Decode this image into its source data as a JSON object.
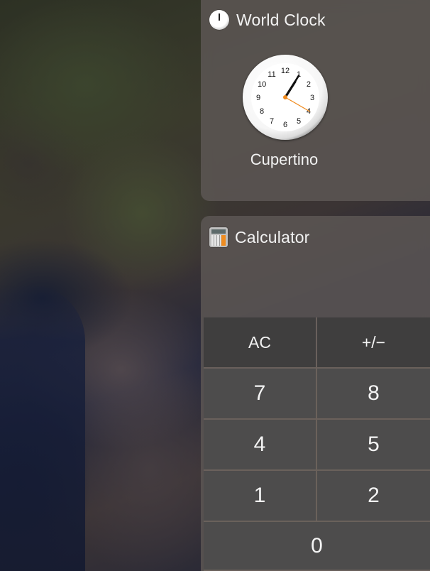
{
  "world_clock": {
    "title": "World Clock",
    "city": "Cupertino",
    "time": {
      "hour": 1,
      "minute": 5,
      "second": 20
    },
    "dial_numbers": [
      "12",
      "1",
      "2",
      "3",
      "4",
      "5",
      "6",
      "7",
      "8",
      "9",
      "10",
      "11"
    ]
  },
  "calculator": {
    "title": "Calculator",
    "keys": {
      "ac": "AC",
      "sign": "+/−",
      "seven": "7",
      "eight": "8",
      "four": "4",
      "five": "5",
      "one": "1",
      "two": "2",
      "zero": "0"
    }
  },
  "colors": {
    "second_hand": "#f08a1c",
    "panel": "#5c5654",
    "key": "#4d4c4c"
  }
}
